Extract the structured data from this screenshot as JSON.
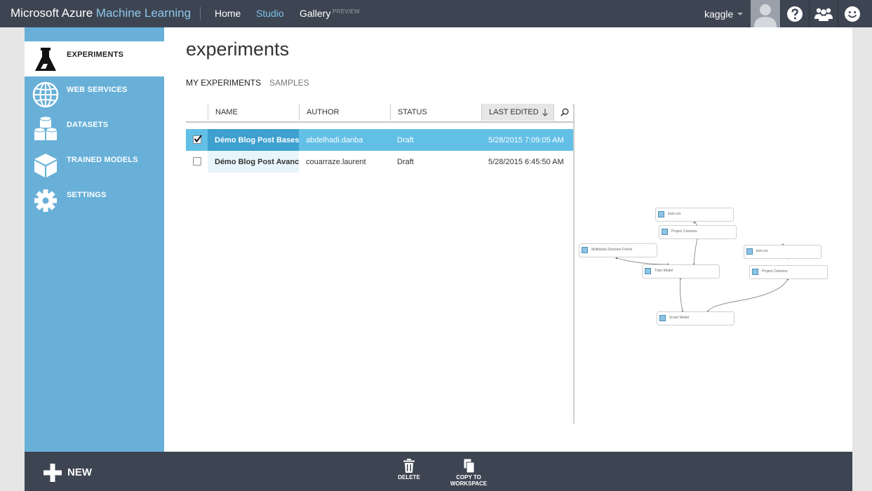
{
  "topbar": {
    "brand_part1": "Microsoft Azure",
    "brand_part2": "Machine Learning",
    "nav": [
      "Home",
      "Studio",
      "Gallery"
    ],
    "gallery_badge": "PREVIEW",
    "user": "kaggle"
  },
  "sidebar": {
    "items": [
      {
        "label": "EXPERIMENTS",
        "icon": "flask-icon"
      },
      {
        "label": "WEB SERVICES",
        "icon": "globe-icon"
      },
      {
        "label": "DATASETS",
        "icon": "database-icon"
      },
      {
        "label": "TRAINED MODELS",
        "icon": "cube-icon"
      },
      {
        "label": "SETTINGS",
        "icon": "gear-icon"
      }
    ]
  },
  "main": {
    "title": "experiments",
    "tabs": [
      "MY EXPERIMENTS",
      "SAMPLES"
    ],
    "columns": [
      "NAME",
      "AUTHOR",
      "STATUS",
      "LAST EDITED"
    ],
    "rows": [
      {
        "name": "Démo Blog Post Bases",
        "author": "abdelhadi.danba",
        "status": "Draft",
        "last_edited": "5/28/2015 7:09:05 AM"
      },
      {
        "name": "Démo Blog Post Avancé",
        "author": "couarraze.laurent",
        "status": "Draft",
        "last_edited": "5/28/2015 6:45:50 AM"
      }
    ]
  },
  "preview_nodes": [
    "train.csv",
    "Project Columns",
    "Multiclass Decision Forest",
    "Train Model",
    "test.csv",
    "Project Columns",
    "Score Model"
  ],
  "bottombar": {
    "new_label": "NEW",
    "delete_label": "DELETE",
    "copy_label_1": "COPY TO",
    "copy_label_2": "WORKSPACE"
  },
  "colors": {
    "topbar": "#3d4552",
    "sidebar": "#68b0d8",
    "selected_row": "#62bfe6",
    "studio_accent": "#7cc1ec"
  }
}
